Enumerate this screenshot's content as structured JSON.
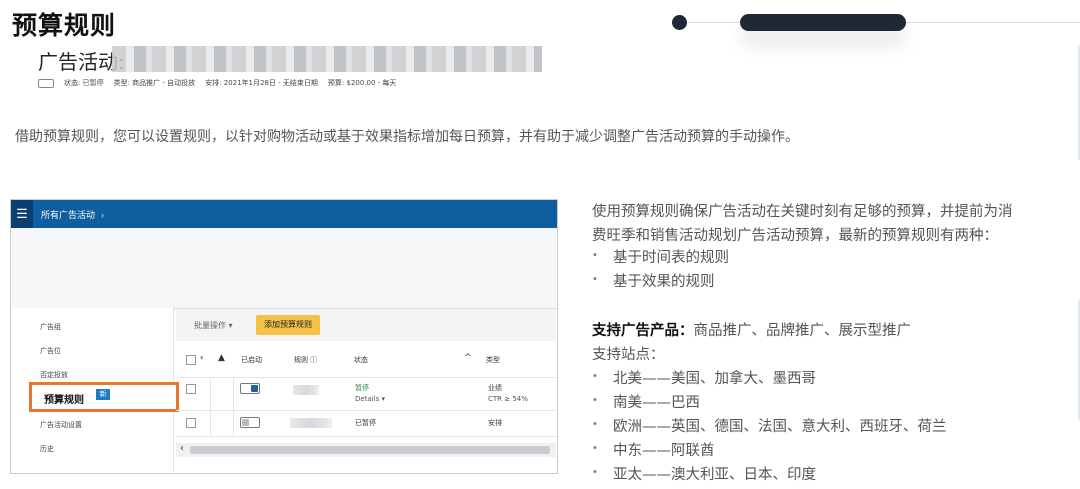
{
  "page": {
    "title": "预算规则",
    "intro": "借助预算规则，您可以设置规则，以针对购物活动或基于效果指标增加每日预算，并有助于减少调整广告活动预算的手动操作。"
  },
  "screenshot": {
    "nav_crumb": "所有广告活动",
    "campaign_title": "广告活动:",
    "meta": {
      "status": "状态: 已暂停",
      "type": "类型: 商品推广 - 自动投放",
      "schedule": "安排: 2021年1月28日 - 无结束日期",
      "budget": "预算: $200.00 - 每天"
    },
    "sidebar": {
      "items": [
        "广告组",
        "广告位",
        "否定投放",
        "广告活动设置",
        "历史"
      ],
      "active": "预算规则",
      "active_badge": "新"
    },
    "toolbar": {
      "bulk": "批量操作",
      "add": "添加预算规则"
    },
    "columns": [
      "已启动",
      "规则",
      "状态",
      "类型"
    ],
    "rows": [
      {
        "status": "暂停",
        "status_sub": "Details ▾",
        "type": "业绩",
        "type_sub": "CTR ≥ 54%"
      },
      {
        "status": "已暂停",
        "status_sub": "",
        "type": "安排",
        "type_sub": ""
      }
    ]
  },
  "right": {
    "para_line1": "使用预算规则确保广告活动在关键时刻有足够的预算，并提前为消",
    "para_line2": "费旺季和销售活动规划广告活动预算，最新的预算规则有两种：",
    "rule_types": [
      "基于时间表的规则",
      "基于效果的规则"
    ],
    "products_label": "支持广告产品：",
    "products": "商品推广、品牌推广、展示型推广",
    "sites_label": "支持站点：",
    "sites": [
      "北美——美国、加拿大、墨西哥",
      "南美——巴西",
      "欧洲——英国、德国、法国、意大利、西班牙、荷兰",
      "中东——阿联酋",
      "亚太——澳大利亚、日本、印度"
    ]
  },
  "colors": {
    "accent_dark": "#1f2836",
    "nav_blue": "#0f5ea0",
    "highlight_orange": "#e8772e",
    "add_button_yellow": "#f3c246"
  }
}
